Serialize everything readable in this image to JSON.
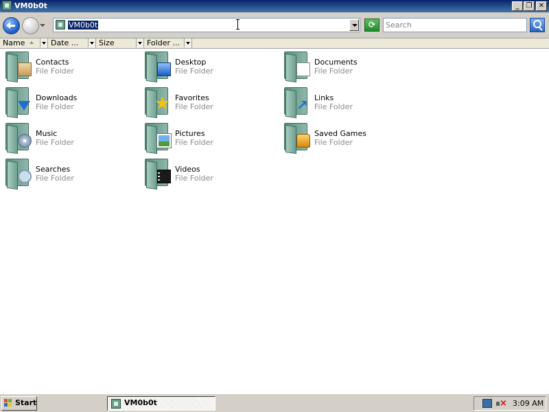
{
  "window": {
    "title": "VM0b0t",
    "minimize_label": "_",
    "restore_label": "❐",
    "close_label": "✕"
  },
  "address_bar": {
    "value": "VM0b0t",
    "refresh_glyph": "⟳"
  },
  "search": {
    "placeholder": "Search"
  },
  "columns": [
    {
      "label": "Name",
      "sorted": "ascending"
    },
    {
      "label": "Date ..."
    },
    {
      "label": "Size"
    },
    {
      "label": "Folder ..."
    }
  ],
  "items": [
    {
      "name": "Contacts",
      "type": "File Folder",
      "icon": "contacts-icon"
    },
    {
      "name": "Desktop",
      "type": "File Folder",
      "icon": "desktop-icon"
    },
    {
      "name": "Documents",
      "type": "File Folder",
      "icon": "documents-icon"
    },
    {
      "name": "Downloads",
      "type": "File Folder",
      "icon": "downloads-icon"
    },
    {
      "name": "Favorites",
      "type": "File Folder",
      "icon": "favorites-icon"
    },
    {
      "name": "Links",
      "type": "File Folder",
      "icon": "links-icon"
    },
    {
      "name": "Music",
      "type": "File Folder",
      "icon": "music-icon"
    },
    {
      "name": "Pictures",
      "type": "File Folder",
      "icon": "pictures-icon"
    },
    {
      "name": "Saved Games",
      "type": "File Folder",
      "icon": "saved-games-icon"
    },
    {
      "name": "Searches",
      "type": "File Folder",
      "icon": "searches-icon"
    },
    {
      "name": "Videos",
      "type": "File Folder",
      "icon": "videos-icon"
    }
  ],
  "taskbar": {
    "start_label": "Start",
    "task_label": "VM0b0t",
    "clock": "3:09 AM"
  },
  "colors": {
    "title_bar": "#0a246a",
    "selection": "#0a246a",
    "folder": "#6e9f90"
  }
}
